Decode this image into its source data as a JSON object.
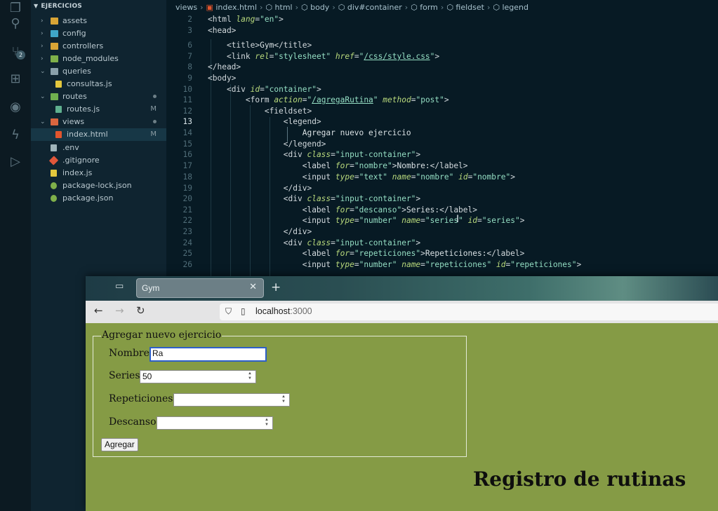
{
  "explorer": {
    "title": "EJERCICIOS",
    "items": [
      {
        "name": "assets",
        "git": ""
      },
      {
        "name": "config",
        "git": ""
      },
      {
        "name": "controllers",
        "git": ""
      },
      {
        "name": "node_modules",
        "git": ""
      },
      {
        "name": "queries",
        "git": ""
      },
      {
        "name": "consultas.js",
        "git": ""
      },
      {
        "name": "routes",
        "git": ""
      },
      {
        "name": "routes.js",
        "git": "M"
      },
      {
        "name": "views",
        "git": ""
      },
      {
        "name": "index.html",
        "git": "M"
      },
      {
        "name": ".env",
        "git": ""
      },
      {
        "name": ".gitignore",
        "git": ""
      },
      {
        "name": "index.js",
        "git": ""
      },
      {
        "name": "package-lock.json",
        "git": ""
      },
      {
        "name": "package.json",
        "git": ""
      }
    ],
    "source_control_badge": "2"
  },
  "editor": {
    "breadcrumb": [
      "views",
      "index.html",
      "html",
      "body",
      "div#container",
      "form",
      "fieldset",
      "legend"
    ],
    "active_line": "13",
    "line_numbers": [
      "2",
      "3",
      "6",
      "7",
      "8",
      "9",
      "10",
      "11",
      "12",
      "13",
      "14",
      "15",
      "16",
      "17",
      "18",
      "19",
      "20",
      "21",
      "22",
      "23",
      "24",
      "25",
      "26"
    ]
  },
  "browser": {
    "tab_title": "Gym",
    "url_host": "localhost",
    "url_port": ":3000",
    "page": {
      "legend": "Agregar nuevo ejercicio",
      "nombre_label": "Nombre:",
      "nombre_value": "Ra",
      "series_label": "Series:",
      "series_value": "50",
      "repeticiones_label": "Repeticiones:",
      "repeticiones_value": "",
      "descanso_label": "Descanso:",
      "descanso_value": "",
      "submit_label": "Agregar",
      "heading": "Registro de rutinas"
    }
  },
  "colors": {
    "page_background": "#859b45",
    "editor_background": "#071a24",
    "explorer_background": "#0f2430",
    "focus_ring": "#2d5fc8"
  }
}
